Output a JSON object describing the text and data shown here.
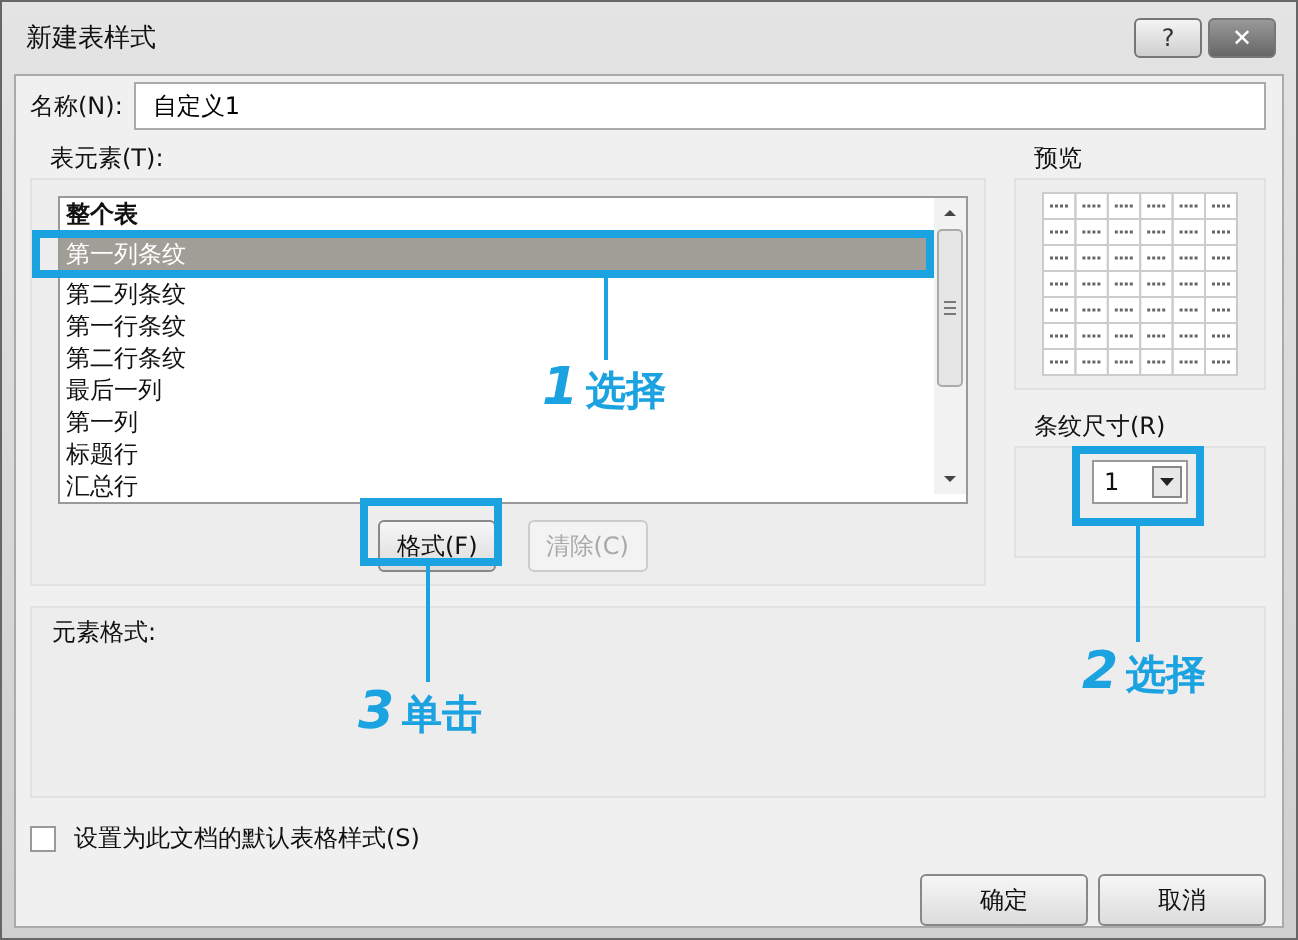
{
  "window": {
    "title": "新建表样式",
    "controls": [
      {
        "kind": "help",
        "label": "?"
      },
      {
        "kind": "close",
        "label": "✕"
      }
    ]
  },
  "name_field": {
    "label": "名称(N):",
    "value": "自定义1"
  },
  "elements": {
    "label": "表元素(T):",
    "items": [
      {
        "text": "整个表",
        "selected": false
      },
      {
        "text": "第一列条纹",
        "selected": true
      },
      {
        "text": "第二列条纹",
        "selected": false
      },
      {
        "text": "第一行条纹",
        "selected": false
      },
      {
        "text": "第二行条纹",
        "selected": false
      },
      {
        "text": "最后一列",
        "selected": false
      },
      {
        "text": "第一列",
        "selected": false
      },
      {
        "text": "标题行",
        "selected": false
      },
      {
        "text": "汇总行",
        "selected": false
      }
    ]
  },
  "element_buttons": [
    {
      "label": "格式(F)",
      "disabled": false
    },
    {
      "label": "清除(C)",
      "disabled": true
    }
  ],
  "preview": {
    "label": "预览"
  },
  "stripe_size": {
    "label": "条纹尺寸(R)",
    "value": "1"
  },
  "element_format": {
    "label": "元素格式:"
  },
  "default_checkbox": {
    "label": "设置为此文档的默认表格样式(S)",
    "checked": false
  },
  "dialog_buttons": [
    {
      "label": "确定"
    },
    {
      "label": "取消"
    }
  ],
  "annotations": [
    {
      "number": "1",
      "text": "选择"
    },
    {
      "number": "2",
      "text": "选择"
    },
    {
      "number": "3",
      "text": "单击"
    }
  ]
}
